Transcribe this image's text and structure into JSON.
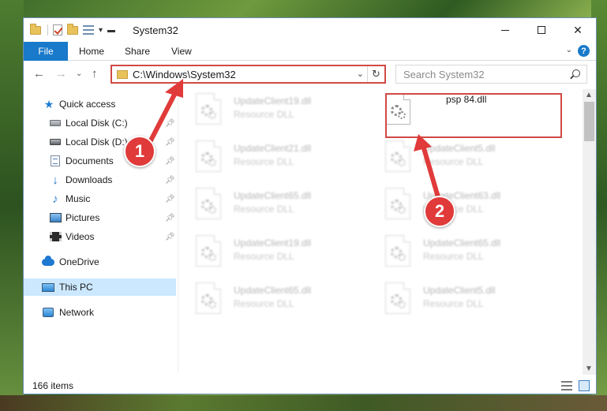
{
  "window": {
    "title": "System32"
  },
  "ribbon": {
    "tabs": [
      "File",
      "Home",
      "Share",
      "View"
    ]
  },
  "address_bar": {
    "path": "C:\\Windows\\System32"
  },
  "search": {
    "placeholder": "Search System32"
  },
  "nav_pane": {
    "items": [
      {
        "label": "Quick access",
        "icon": "star-icon"
      },
      {
        "label": "Local Disk (C:)",
        "icon": "disk-icon"
      },
      {
        "label": "Local Disk (D:)",
        "icon": "disk-icon"
      },
      {
        "label": "Documents",
        "icon": "documents-icon"
      },
      {
        "label": "Downloads",
        "icon": "download-icon"
      },
      {
        "label": "Music",
        "icon": "music-icon"
      },
      {
        "label": "Pictures",
        "icon": "pictures-icon"
      },
      {
        "label": "Videos",
        "icon": "videos-icon"
      },
      {
        "label": "OneDrive",
        "icon": "cloud-icon"
      },
      {
        "label": "This PC",
        "icon": "computer-icon",
        "selected": true
      },
      {
        "label": "Network",
        "icon": "network-icon"
      }
    ]
  },
  "files": [
    {
      "name": "UpdateClient19.dll",
      "type": "Resource DLL"
    },
    {
      "name": "psp 84.dll",
      "type": ""
    },
    {
      "name": "UpdateClient21.dll",
      "type": "Resource DLL"
    },
    {
      "name": "UpdateClient5.dll",
      "type": "Resource DLL"
    },
    {
      "name": "UpdateClient65.dll",
      "type": "Resource DLL"
    },
    {
      "name": "UpdateClient63.dll",
      "type": "Resource DLL"
    },
    {
      "name": "UpdateClient19.dll",
      "type": "Resource DLL"
    },
    {
      "name": "UpdateClient65.dll",
      "type": "Resource DLL"
    },
    {
      "name": "UpdateClient65.dll",
      "type": "Resource DLL"
    },
    {
      "name": "UpdateClient5.dll",
      "type": "Resource DLL"
    }
  ],
  "status": {
    "item_count": "166 items"
  },
  "markers": {
    "one": "1",
    "two": "2"
  },
  "colors": {
    "accent": "#1979ca",
    "highlight": "#d04a44",
    "marker": "#e03a3a",
    "selection": "#cce8ff"
  }
}
